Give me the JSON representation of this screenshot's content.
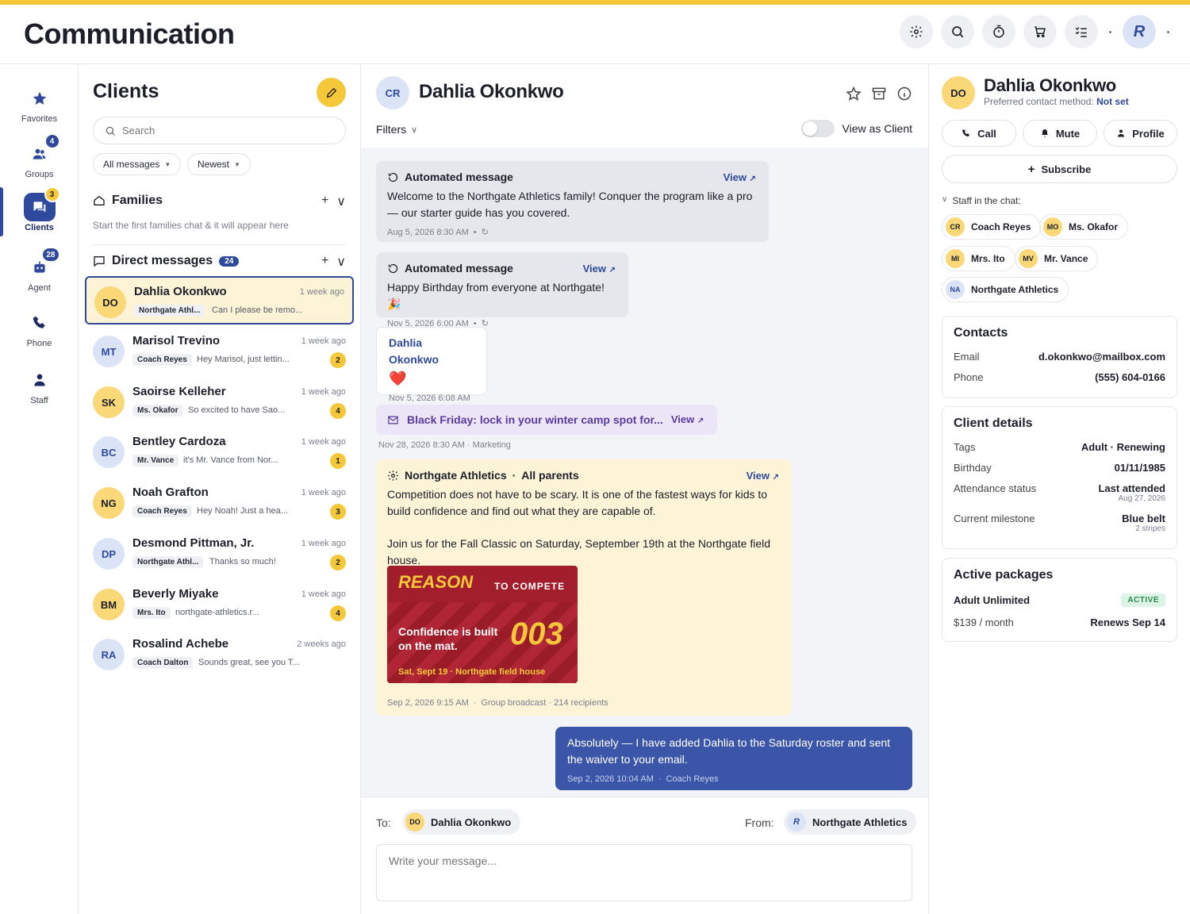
{
  "app": {
    "title": "Communication"
  },
  "header": {
    "user_initial": "R"
  },
  "nav": [
    {
      "label": "Favorites",
      "badge": ""
    },
    {
      "label": "Groups",
      "badge": "4"
    },
    {
      "label": "Clients",
      "badge": "3"
    },
    {
      "label": "Agent",
      "badge": "28"
    },
    {
      "label": "Phone",
      "badge": ""
    },
    {
      "label": "Staff",
      "badge": ""
    }
  ],
  "clients": {
    "title": "Clients",
    "search_placeholder": "Search",
    "filter_all": "All messages",
    "filter_sort": "Newest",
    "families_title": "Families",
    "families_note": "Start the first families chat & it will appear here",
    "direct_title": "Direct messages",
    "direct_count": "24",
    "list": [
      {
        "initials": "DO",
        "name": "Dahlia Okonkwo",
        "time": "1 week ago",
        "tag": "Northgate Athl...",
        "preview": "Can I please be remo...",
        "badge": ""
      },
      {
        "initials": "MT",
        "name": "Marisol Trevino",
        "time": "1 week ago",
        "tag": "Coach Reyes",
        "preview": "Hey Marisol, just lettin...",
        "badge": "2"
      },
      {
        "initials": "SK",
        "name": "Saoirse Kelleher",
        "time": "1 week ago",
        "tag": "Ms. Okafor",
        "preview": "So excited to have Sao...",
        "badge": "4"
      },
      {
        "initials": "BC",
        "name": "Bentley Cardoza",
        "time": "1 week ago",
        "tag": "Mr. Vance",
        "preview": "it's Mr. Vance from Nor...",
        "badge": "1"
      },
      {
        "initials": "NG",
        "name": "Noah Grafton",
        "time": "1 week ago",
        "tag": "Coach Reyes",
        "preview": "Hey Noah! Just a hea...",
        "badge": "3"
      },
      {
        "initials": "DP",
        "name": "Desmond Pittman, Jr.",
        "time": "1 week ago",
        "tag": "Northgate Athl...",
        "preview": "Thanks so much!",
        "badge": "2"
      },
      {
        "initials": "BM",
        "name": "Beverly Miyake",
        "time": "1 week ago",
        "tag": "Mrs. Ito",
        "preview": "northgate-athletics.r...",
        "badge": "4"
      },
      {
        "initials": "RA",
        "name": "Rosalind Achebe",
        "time": "2 weeks ago",
        "tag": "Coach Dalton",
        "preview": "Sounds great, see you T...",
        "badge": ""
      }
    ]
  },
  "chat": {
    "initials": "CR",
    "name": "Dahlia Okonkwo",
    "filters_label": "Filters",
    "view_as_client": "View as Client",
    "view_label": "View",
    "msg1": {
      "title": "Automated message",
      "text": "Welcome to the Northgate Athletics family! Conquer the program like a pro — our starter guide has you covered.",
      "meta": "Aug 5, 2026 8:30 AM"
    },
    "msg2": {
      "title": "Automated message",
      "text": "Happy Birthday from everyone at Northgate! 🎉",
      "meta": "Nov 5, 2026 6:00 AM"
    },
    "msg3": {
      "who": "Dahlia Okonkwo",
      "text": "❤️",
      "meta": "Nov 5, 2026 6:08 AM"
    },
    "msg4": {
      "text": "Black Friday: lock in your winter camp spot for...",
      "meta": "Nov 28, 2026 8:30 AM · Marketing"
    },
    "msg5": {
      "sender": "Northgate Athletics",
      "audience": "All parents",
      "p1": "Competition does not have to be scary. It is one of the fastest ways for kids to build confidence and find out what they are capable of.",
      "p2": "Join us for the Fall Classic on Saturday, September 19th at the Northgate field house.",
      "poster_word": "REASON",
      "poster_tag": "TO COMPETE",
      "poster_line": "Confidence is built on the mat.",
      "poster_num": "003",
      "poster_foot": "Sat, Sept 19 · Northgate field house",
      "meta": "Sep 2, 2026 9:15 AM",
      "meta2": "Group broadcast · 214 recipients"
    },
    "msg6": {
      "text": "Absolutely — I have added Dahlia to the Saturday roster and sent the waiver to your email.",
      "meta": "Sep 2, 2026 10:04 AM",
      "meta2": "Coach Reyes"
    },
    "to_label": "To:",
    "to_initials": "DO",
    "to_name": "Dahlia Okonkwo",
    "from_label": "From:",
    "from_initial": "R",
    "from_name": "Northgate Athletics",
    "input_placeholder": "Write your message..."
  },
  "details": {
    "initials": "DO",
    "name": "Dahlia Okonkwo",
    "pref_label": "Preferred contact method:",
    "pref_value": "Not set",
    "call": "Call",
    "mute": "Mute",
    "profile": "Profile",
    "subscribe": "Subscribe",
    "staff_label": "Staff in the chat:",
    "staff": [
      {
        "initials": "CR",
        "name": "Coach Reyes"
      },
      {
        "initials": "MO",
        "name": "Ms. Okafor"
      },
      {
        "initials": "MI",
        "name": "Mrs. Ito"
      },
      {
        "initials": "MV",
        "name": "Mr. Vance"
      },
      {
        "initials": "NA",
        "name": "Northgate Athletics"
      }
    ],
    "contacts_title": "Contacts",
    "email_label": "Email",
    "email": "d.okonkwo@mailbox.com",
    "phone_label": "Phone",
    "phone": "(555) 604-0166",
    "client_title": "Client details",
    "tags_label": "Tags",
    "tags": "Adult · Renewing",
    "birthday_label": "Birthday",
    "birthday": "01/11/1985",
    "attendance_label": "Attendance status",
    "attendance": "Last attended",
    "attendance_sub": "Aug 27, 2026",
    "milestone_label": "Current milestone",
    "milestone": "Blue belt",
    "milestone_sub": "2 stripes",
    "packages_title": "Active packages",
    "package_name": "Adult Unlimited",
    "package_status": "ACTIVE",
    "package_price": "$139 / month",
    "package_renew": "Renews Sep 14"
  },
  "colors": {
    "accent": "#2f4a9c",
    "brand_yellow": "#f5c83a",
    "purple": "#5a3aa0",
    "poster_red": "#a21e2c"
  }
}
